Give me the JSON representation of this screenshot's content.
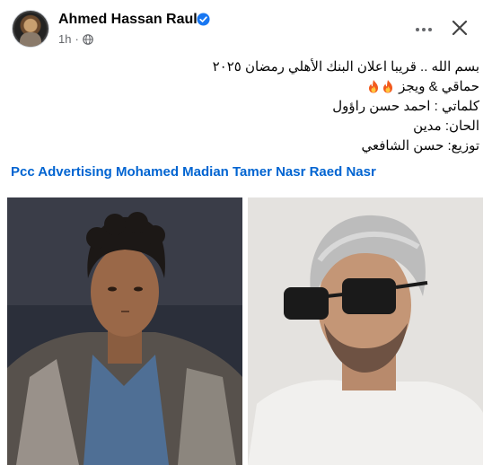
{
  "post": {
    "author": "Ahmed Hassan Raul",
    "timestamp": "1h",
    "visibility_icon": "globe-icon",
    "verified_icon": "verified-badge-icon",
    "more_icon": "more-dots-icon",
    "close_icon": "close-icon",
    "text_lines": [
      "بسم الله .. قريبا اعلان البنك الأهلي رمضان ٢٠٢٥",
      "حماقي & ويجز",
      "كلماتي : احمد حسن راؤول",
      "الحان: مدين",
      "توزيع: حسن الشافعي"
    ],
    "fire_emoji_count": 2,
    "hashtags": "Pcc Advertising Mohamed Madian Tamer Nasr Raed Nasr"
  },
  "colors": {
    "link": "#0064d1",
    "verified": "#1877f2",
    "secondary_text": "#65676b"
  },
  "images": [
    {
      "name": "photo-man-curly-hair"
    },
    {
      "name": "photo-man-sunglasses"
    }
  ]
}
